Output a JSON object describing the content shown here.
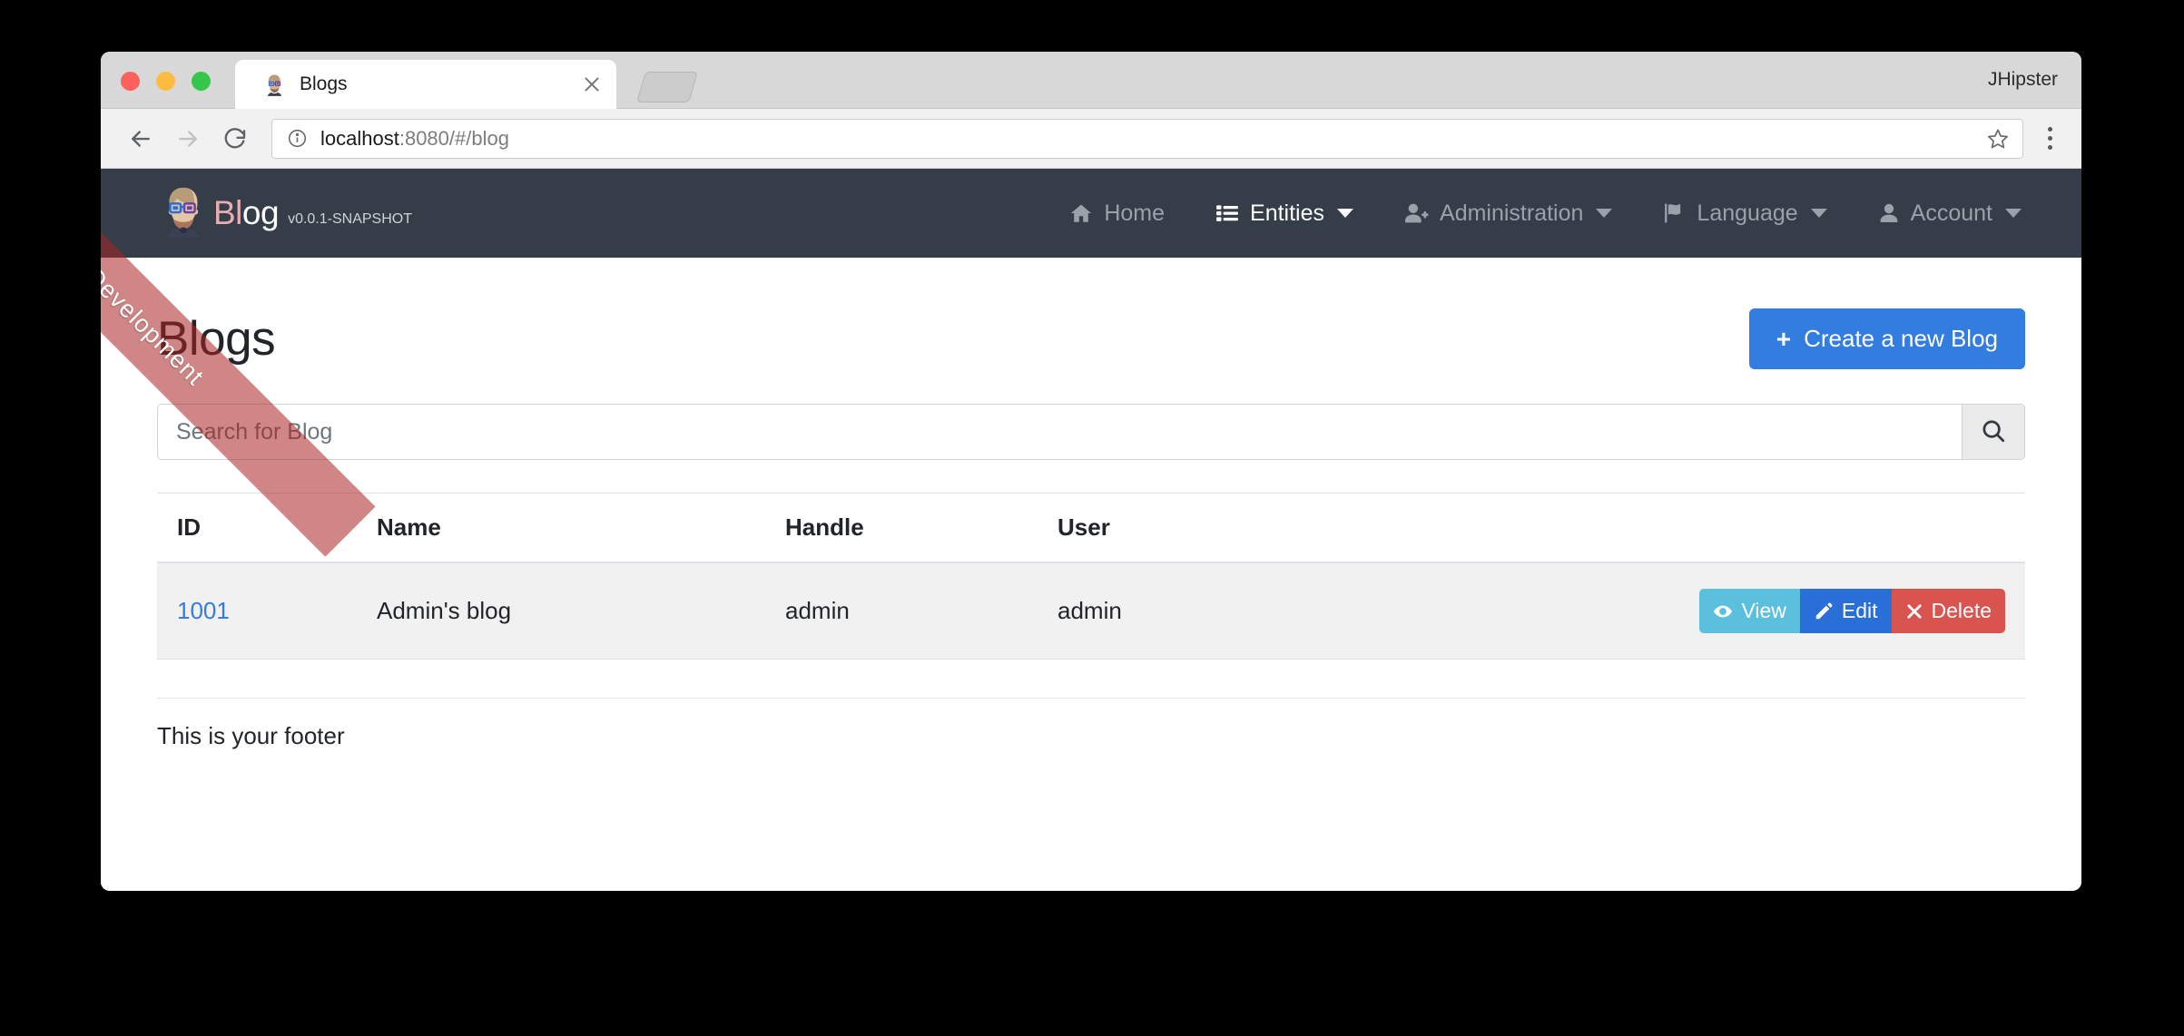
{
  "browser": {
    "window_brand_label": "JHipster",
    "tab": {
      "title": "Blogs",
      "favicon_name": "jhipster-favicon",
      "close_label": "×"
    },
    "newtab_name": "new-tab-button",
    "toolbar": {
      "back_label": "Back",
      "forward_label": "Forward",
      "reload_label": "Reload",
      "bookmark_label": "Bookmark",
      "menu_label": "Menu"
    },
    "address": {
      "host": "localhost",
      "rest": ":8080/#/blog",
      "full": "localhost:8080/#/blog",
      "security_icon": "info-circle-icon"
    }
  },
  "ribbon": {
    "label": "Development",
    "color": "#aa2323"
  },
  "navbar": {
    "brand": {
      "logo_name": "jhipster-hipster-logo",
      "name_part1": "Bl",
      "name_part2": "og",
      "version": "v0.0.1-SNAPSHOT"
    },
    "items": [
      {
        "label": "Home",
        "icon": "home-icon",
        "active": false,
        "dropdown": false
      },
      {
        "label": "Entities",
        "icon": "list-icon",
        "active": true,
        "dropdown": true
      },
      {
        "label": "Administration",
        "icon": "user-plus-icon",
        "active": false,
        "dropdown": true
      },
      {
        "label": "Language",
        "icon": "flag-icon",
        "active": false,
        "dropdown": true
      },
      {
        "label": "Account",
        "icon": "user-icon",
        "active": false,
        "dropdown": true
      }
    ]
  },
  "page": {
    "title": "Blogs",
    "create_button": {
      "label": "Create a new Blog",
      "icon": "plus-icon",
      "color": "#337ce0"
    },
    "search": {
      "placeholder": "Search for Blog",
      "value": "",
      "button_icon": "search-icon"
    },
    "table": {
      "columns": [
        "ID",
        "Name",
        "Handle",
        "User"
      ],
      "rows": [
        {
          "id": "1001",
          "name": "Admin's blog",
          "handle": "admin",
          "user": "admin",
          "actions": [
            {
              "label": "View",
              "icon": "eye-icon",
              "color": "#5bc0de"
            },
            {
              "label": "Edit",
              "icon": "pencil-icon",
              "color": "#2a6ed8"
            },
            {
              "label": "Delete",
              "icon": "times-icon",
              "color": "#d9534f"
            }
          ]
        }
      ]
    }
  },
  "footer": {
    "text": "This is your footer"
  }
}
